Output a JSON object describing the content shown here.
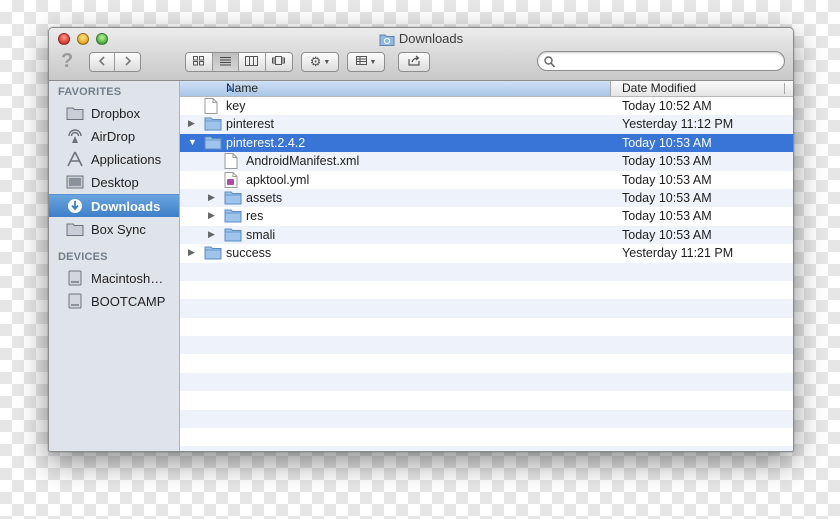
{
  "window": {
    "title": "Downloads",
    "title_icon": "folder-icon"
  },
  "toolbar": {
    "help_label": "?",
    "back_icon": "chevron-left-icon",
    "forward_icon": "chevron-right-icon",
    "view_buttons": [
      "icon-view-icon",
      "list-view-icon",
      "column-view-icon",
      "coverflow-view-icon"
    ],
    "active_view": "list-view-icon",
    "action_icon": "gear-icon",
    "arrange_icon": "arrange-icon",
    "share_icon": "share-icon",
    "search": {
      "value": "",
      "placeholder": ""
    }
  },
  "sidebar": {
    "favorites_header": "FAVORITES",
    "favorites": [
      {
        "label": "Dropbox",
        "icon": "folder-icon"
      },
      {
        "label": "AirDrop",
        "icon": "airdrop-icon"
      },
      {
        "label": "Applications",
        "icon": "applications-icon"
      },
      {
        "label": "Desktop",
        "icon": "desktop-icon"
      },
      {
        "label": "Downloads",
        "icon": "downloads-icon",
        "selected": true
      },
      {
        "label": "Box Sync",
        "icon": "folder-icon"
      }
    ],
    "devices_header": "DEVICES",
    "devices": [
      {
        "label": "Macintosh…",
        "icon": "hard-drive-icon"
      },
      {
        "label": "BOOTCAMP",
        "icon": "hard-drive-icon"
      }
    ]
  },
  "columns": {
    "name": "Name",
    "date": "Date Modified"
  },
  "files": [
    {
      "name": "key",
      "date": "Today 10:52 AM",
      "kind": "file",
      "level": 0,
      "disclosure": "none"
    },
    {
      "name": "pinterest",
      "date": "Yesterday 11:12 PM",
      "kind": "folder",
      "level": 0,
      "disclosure": "collapsed"
    },
    {
      "name": "pinterest.2.4.2",
      "date": "Today 10:53 AM",
      "kind": "folder",
      "level": 0,
      "disclosure": "expanded",
      "selected": true
    },
    {
      "name": "AndroidManifest.xml",
      "date": "Today 10:53 AM",
      "kind": "file",
      "level": 1,
      "disclosure": "none"
    },
    {
      "name": "apktool.yml",
      "date": "Today 10:53 AM",
      "kind": "yml",
      "level": 1,
      "disclosure": "none"
    },
    {
      "name": "assets",
      "date": "Today 10:53 AM",
      "kind": "folder",
      "level": 1,
      "disclosure": "collapsed"
    },
    {
      "name": "res",
      "date": "Today 10:53 AM",
      "kind": "folder",
      "level": 1,
      "disclosure": "collapsed"
    },
    {
      "name": "smali",
      "date": "Today 10:53 AM",
      "kind": "folder",
      "level": 1,
      "disclosure": "collapsed"
    },
    {
      "name": "success",
      "date": "Yesterday 11:21 PM",
      "kind": "folder",
      "level": 0,
      "disclosure": "collapsed"
    }
  ],
  "colors": {
    "selection_blue": "#3875d7",
    "sidebar_bg": "#dfe4ea",
    "stripe": "#eef3fb"
  }
}
